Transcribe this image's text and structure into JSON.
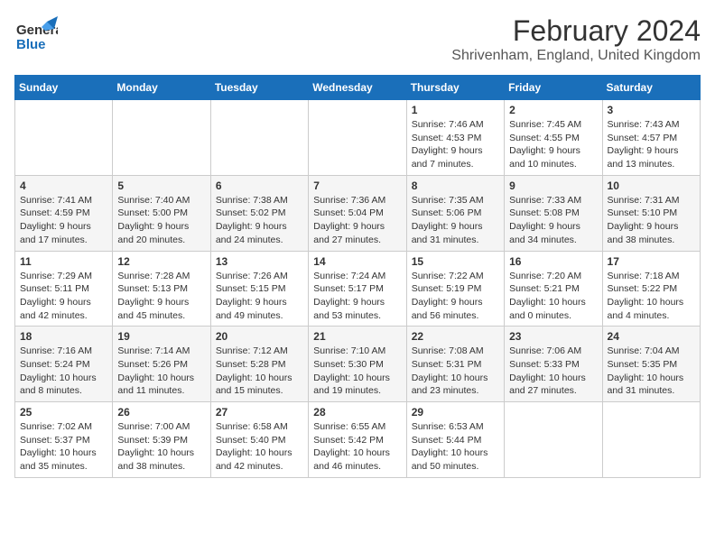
{
  "header": {
    "logo_line1": "General",
    "logo_line2": "Blue",
    "month": "February 2024",
    "location": "Shrivenham, England, United Kingdom"
  },
  "days_of_week": [
    "Sunday",
    "Monday",
    "Tuesday",
    "Wednesday",
    "Thursday",
    "Friday",
    "Saturday"
  ],
  "weeks": [
    [
      {
        "day": "",
        "info": ""
      },
      {
        "day": "",
        "info": ""
      },
      {
        "day": "",
        "info": ""
      },
      {
        "day": "",
        "info": ""
      },
      {
        "day": "1",
        "info": "Sunrise: 7:46 AM\nSunset: 4:53 PM\nDaylight: 9 hours\nand 7 minutes."
      },
      {
        "day": "2",
        "info": "Sunrise: 7:45 AM\nSunset: 4:55 PM\nDaylight: 9 hours\nand 10 minutes."
      },
      {
        "day": "3",
        "info": "Sunrise: 7:43 AM\nSunset: 4:57 PM\nDaylight: 9 hours\nand 13 minutes."
      }
    ],
    [
      {
        "day": "4",
        "info": "Sunrise: 7:41 AM\nSunset: 4:59 PM\nDaylight: 9 hours\nand 17 minutes."
      },
      {
        "day": "5",
        "info": "Sunrise: 7:40 AM\nSunset: 5:00 PM\nDaylight: 9 hours\nand 20 minutes."
      },
      {
        "day": "6",
        "info": "Sunrise: 7:38 AM\nSunset: 5:02 PM\nDaylight: 9 hours\nand 24 minutes."
      },
      {
        "day": "7",
        "info": "Sunrise: 7:36 AM\nSunset: 5:04 PM\nDaylight: 9 hours\nand 27 minutes."
      },
      {
        "day": "8",
        "info": "Sunrise: 7:35 AM\nSunset: 5:06 PM\nDaylight: 9 hours\nand 31 minutes."
      },
      {
        "day": "9",
        "info": "Sunrise: 7:33 AM\nSunset: 5:08 PM\nDaylight: 9 hours\nand 34 minutes."
      },
      {
        "day": "10",
        "info": "Sunrise: 7:31 AM\nSunset: 5:10 PM\nDaylight: 9 hours\nand 38 minutes."
      }
    ],
    [
      {
        "day": "11",
        "info": "Sunrise: 7:29 AM\nSunset: 5:11 PM\nDaylight: 9 hours\nand 42 minutes."
      },
      {
        "day": "12",
        "info": "Sunrise: 7:28 AM\nSunset: 5:13 PM\nDaylight: 9 hours\nand 45 minutes."
      },
      {
        "day": "13",
        "info": "Sunrise: 7:26 AM\nSunset: 5:15 PM\nDaylight: 9 hours\nand 49 minutes."
      },
      {
        "day": "14",
        "info": "Sunrise: 7:24 AM\nSunset: 5:17 PM\nDaylight: 9 hours\nand 53 minutes."
      },
      {
        "day": "15",
        "info": "Sunrise: 7:22 AM\nSunset: 5:19 PM\nDaylight: 9 hours\nand 56 minutes."
      },
      {
        "day": "16",
        "info": "Sunrise: 7:20 AM\nSunset: 5:21 PM\nDaylight: 10 hours\nand 0 minutes."
      },
      {
        "day": "17",
        "info": "Sunrise: 7:18 AM\nSunset: 5:22 PM\nDaylight: 10 hours\nand 4 minutes."
      }
    ],
    [
      {
        "day": "18",
        "info": "Sunrise: 7:16 AM\nSunset: 5:24 PM\nDaylight: 10 hours\nand 8 minutes."
      },
      {
        "day": "19",
        "info": "Sunrise: 7:14 AM\nSunset: 5:26 PM\nDaylight: 10 hours\nand 11 minutes."
      },
      {
        "day": "20",
        "info": "Sunrise: 7:12 AM\nSunset: 5:28 PM\nDaylight: 10 hours\nand 15 minutes."
      },
      {
        "day": "21",
        "info": "Sunrise: 7:10 AM\nSunset: 5:30 PM\nDaylight: 10 hours\nand 19 minutes."
      },
      {
        "day": "22",
        "info": "Sunrise: 7:08 AM\nSunset: 5:31 PM\nDaylight: 10 hours\nand 23 minutes."
      },
      {
        "day": "23",
        "info": "Sunrise: 7:06 AM\nSunset: 5:33 PM\nDaylight: 10 hours\nand 27 minutes."
      },
      {
        "day": "24",
        "info": "Sunrise: 7:04 AM\nSunset: 5:35 PM\nDaylight: 10 hours\nand 31 minutes."
      }
    ],
    [
      {
        "day": "25",
        "info": "Sunrise: 7:02 AM\nSunset: 5:37 PM\nDaylight: 10 hours\nand 35 minutes."
      },
      {
        "day": "26",
        "info": "Sunrise: 7:00 AM\nSunset: 5:39 PM\nDaylight: 10 hours\nand 38 minutes."
      },
      {
        "day": "27",
        "info": "Sunrise: 6:58 AM\nSunset: 5:40 PM\nDaylight: 10 hours\nand 42 minutes."
      },
      {
        "day": "28",
        "info": "Sunrise: 6:55 AM\nSunset: 5:42 PM\nDaylight: 10 hours\nand 46 minutes."
      },
      {
        "day": "29",
        "info": "Sunrise: 6:53 AM\nSunset: 5:44 PM\nDaylight: 10 hours\nand 50 minutes."
      },
      {
        "day": "",
        "info": ""
      },
      {
        "day": "",
        "info": ""
      }
    ]
  ]
}
